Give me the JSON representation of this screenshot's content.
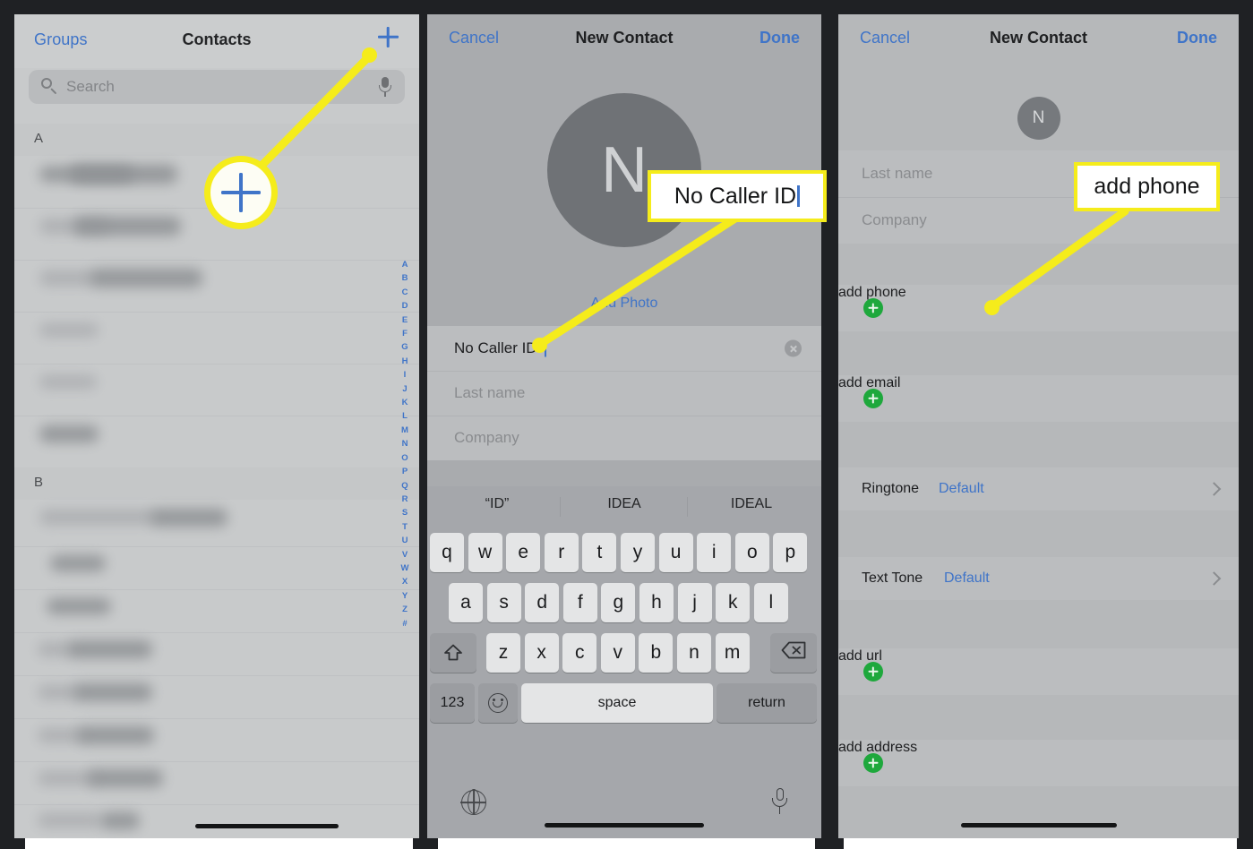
{
  "colors": {
    "highlight": "#f5ec1b",
    "ios_blue": "#3f74c8",
    "green_add": "#1ea83c",
    "panel1_bg": "#c8cacb",
    "panel2_bg": "#a9abae",
    "panel3_bg": "#b6b8ba"
  },
  "panel1": {
    "nav": {
      "left_label": "Groups",
      "title": "Contacts",
      "add_icon": "plus-icon"
    },
    "search": {
      "placeholder": "Search",
      "icon": "search-icon",
      "mic_icon": "microphone-icon"
    },
    "sections": [
      {
        "letter": "A"
      },
      {
        "letter": "B"
      }
    ],
    "index_letters": [
      "A",
      "B",
      "C",
      "D",
      "E",
      "F",
      "G",
      "H",
      "I",
      "J",
      "K",
      "L",
      "M",
      "N",
      "O",
      "P",
      "Q",
      "R",
      "S",
      "T",
      "U",
      "V",
      "W",
      "X",
      "Y",
      "Z",
      "#"
    ]
  },
  "panel2": {
    "nav": {
      "cancel": "Cancel",
      "title": "New Contact",
      "done": "Done"
    },
    "avatar_letter": "N",
    "add_photo": "Add Photo",
    "fields": [
      {
        "name": "first-name",
        "value": "No Caller ID",
        "filled": true,
        "clear_icon": "clear-circle-icon"
      },
      {
        "name": "last-name",
        "placeholder": "Last name",
        "filled": false
      },
      {
        "name": "company",
        "placeholder": "Company",
        "filled": false
      }
    ],
    "keyboard": {
      "predictions": [
        "“ID”",
        "IDEA",
        "IDEAL"
      ],
      "row1": [
        "q",
        "w",
        "e",
        "r",
        "t",
        "y",
        "u",
        "i",
        "o",
        "p"
      ],
      "row2": [
        "a",
        "s",
        "d",
        "f",
        "g",
        "h",
        "j",
        "k",
        "l"
      ],
      "row3": [
        "z",
        "x",
        "c",
        "v",
        "b",
        "n",
        "m"
      ],
      "shift_icon": "shift-arrow-icon",
      "delete_icon": "backspace-icon",
      "numeric_label": "123",
      "emoji_icon": "emoji-smiley-icon",
      "space_label": "space",
      "return_label": "return",
      "globe_icon": "globe-icon",
      "dictation_icon": "microphone-icon"
    }
  },
  "panel3": {
    "nav": {
      "cancel": "Cancel",
      "title": "New Contact",
      "done": "Done"
    },
    "avatar_letter": "N",
    "fields": [
      {
        "name": "last-name",
        "placeholder": "Last name"
      },
      {
        "name": "company",
        "placeholder": "Company"
      }
    ],
    "actions": [
      {
        "name": "add-phone",
        "label": "add phone",
        "icon": "plus-circle-green-icon"
      },
      {
        "name": "add-email",
        "label": "add email",
        "icon": "plus-circle-green-icon"
      },
      {
        "name": "add-url",
        "label": "add url",
        "icon": "plus-circle-green-icon"
      },
      {
        "name": "add-address",
        "label": "add address",
        "icon": "plus-circle-green-icon"
      }
    ],
    "tones": [
      {
        "name": "ringtone",
        "label": "Ringtone",
        "value": "Default",
        "chevron": "chevron-right-icon"
      },
      {
        "name": "text-tone",
        "label": "Text Tone",
        "value": "Default",
        "chevron": "chevron-right-icon"
      }
    ]
  },
  "annotations": {
    "plus_ring": {
      "icon": "plus-icon"
    },
    "callout_name": {
      "text": "No Caller ID",
      "has_cursor": true
    },
    "callout_phone": {
      "text": "add phone",
      "has_cursor": false
    }
  }
}
